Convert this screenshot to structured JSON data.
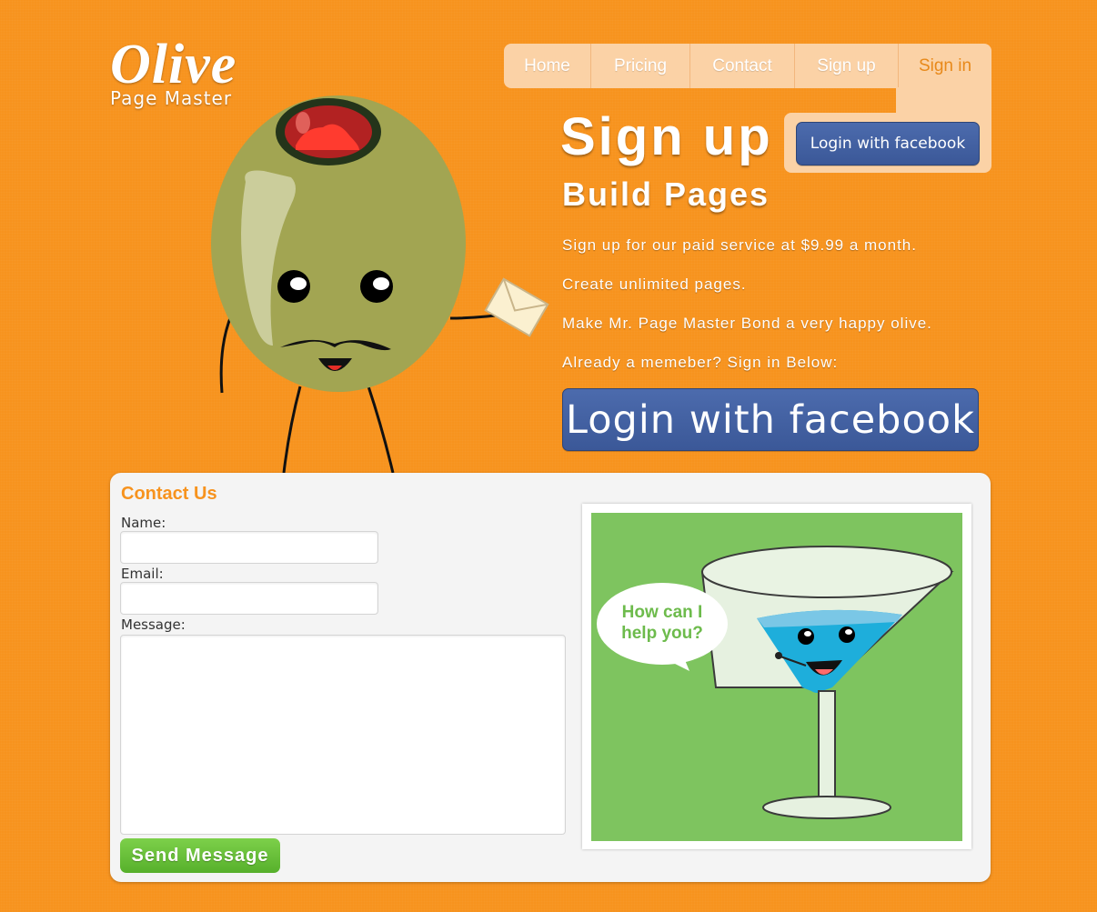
{
  "brand": {
    "title": "Olive",
    "subtitle": "Page Master"
  },
  "nav": {
    "items": [
      {
        "label": "Home",
        "active": false
      },
      {
        "label": "Pricing",
        "active": false
      },
      {
        "label": "Contact",
        "active": false
      },
      {
        "label": "Sign up",
        "active": false
      },
      {
        "label": "Sign in",
        "active": true
      }
    ]
  },
  "signin_panel": {
    "facebook_label": "Login with facebook"
  },
  "hero": {
    "headline": "Sign up",
    "subheadline": "Build Pages",
    "lines": [
      "Sign up for our paid service at $9.99 a month.",
      "Create unlimited pages.",
      "Make Mr. Page Master Bond a very happy olive.",
      "Already a memeber?  Sign in Below:"
    ],
    "facebook_label": "Login with facebook"
  },
  "contact": {
    "title": "Contact Us",
    "name_label": "Name:",
    "name_value": "",
    "email_label": "Email:",
    "email_value": "",
    "message_label": "Message:",
    "message_value": "",
    "send_label": "Send Message",
    "bubble_lines": [
      "How can I",
      "help you?"
    ]
  },
  "colors": {
    "background": "#f7931e",
    "nav_bg": "#fbd2a6",
    "facebook": "#3b5898",
    "send_green": "#62bb35",
    "illustration_bg": "#7ec45f"
  }
}
